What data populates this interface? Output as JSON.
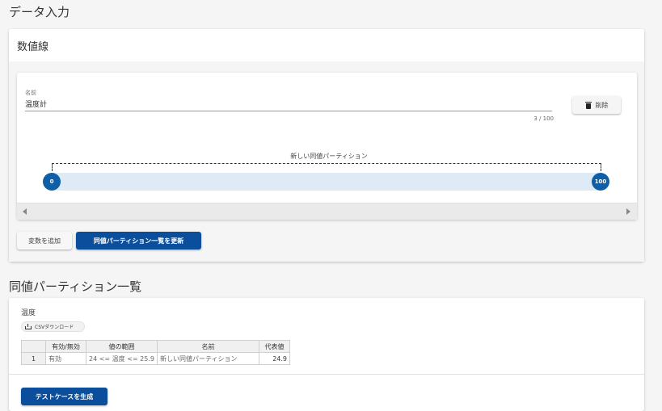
{
  "page": {
    "title": "データ入力"
  },
  "number_line": {
    "title": "数値線",
    "name_label": "名前",
    "name_value": "温度計",
    "char_counter": "3 / 100",
    "delete_label": "削除",
    "partition_label": "新しい同値パーティション",
    "min_value": "0",
    "max_value": "100",
    "add_variable_label": "変数を追加",
    "update_list_label": "同値パーティション一覧を更新"
  },
  "partition_list": {
    "title": "同値パーティション一覧",
    "variable_title": "温度",
    "csv_download_label": "CSVダウンロード",
    "headers": [
      "",
      "有効/無効",
      "値の範囲",
      "名前",
      "代表値"
    ],
    "rows": [
      [
        "1",
        "有効",
        "24 <= 温度 <= 25.9",
        "新しい同値パーティション",
        "24.9"
      ]
    ],
    "generate_label": "テストケースを生成"
  },
  "colors": {
    "primary": "#0b4f9c",
    "handle": "#0f5fa8",
    "range_fill": "#deeaf6"
  },
  "icons": {
    "delete": "trash-icon",
    "csv": "download-icon"
  }
}
